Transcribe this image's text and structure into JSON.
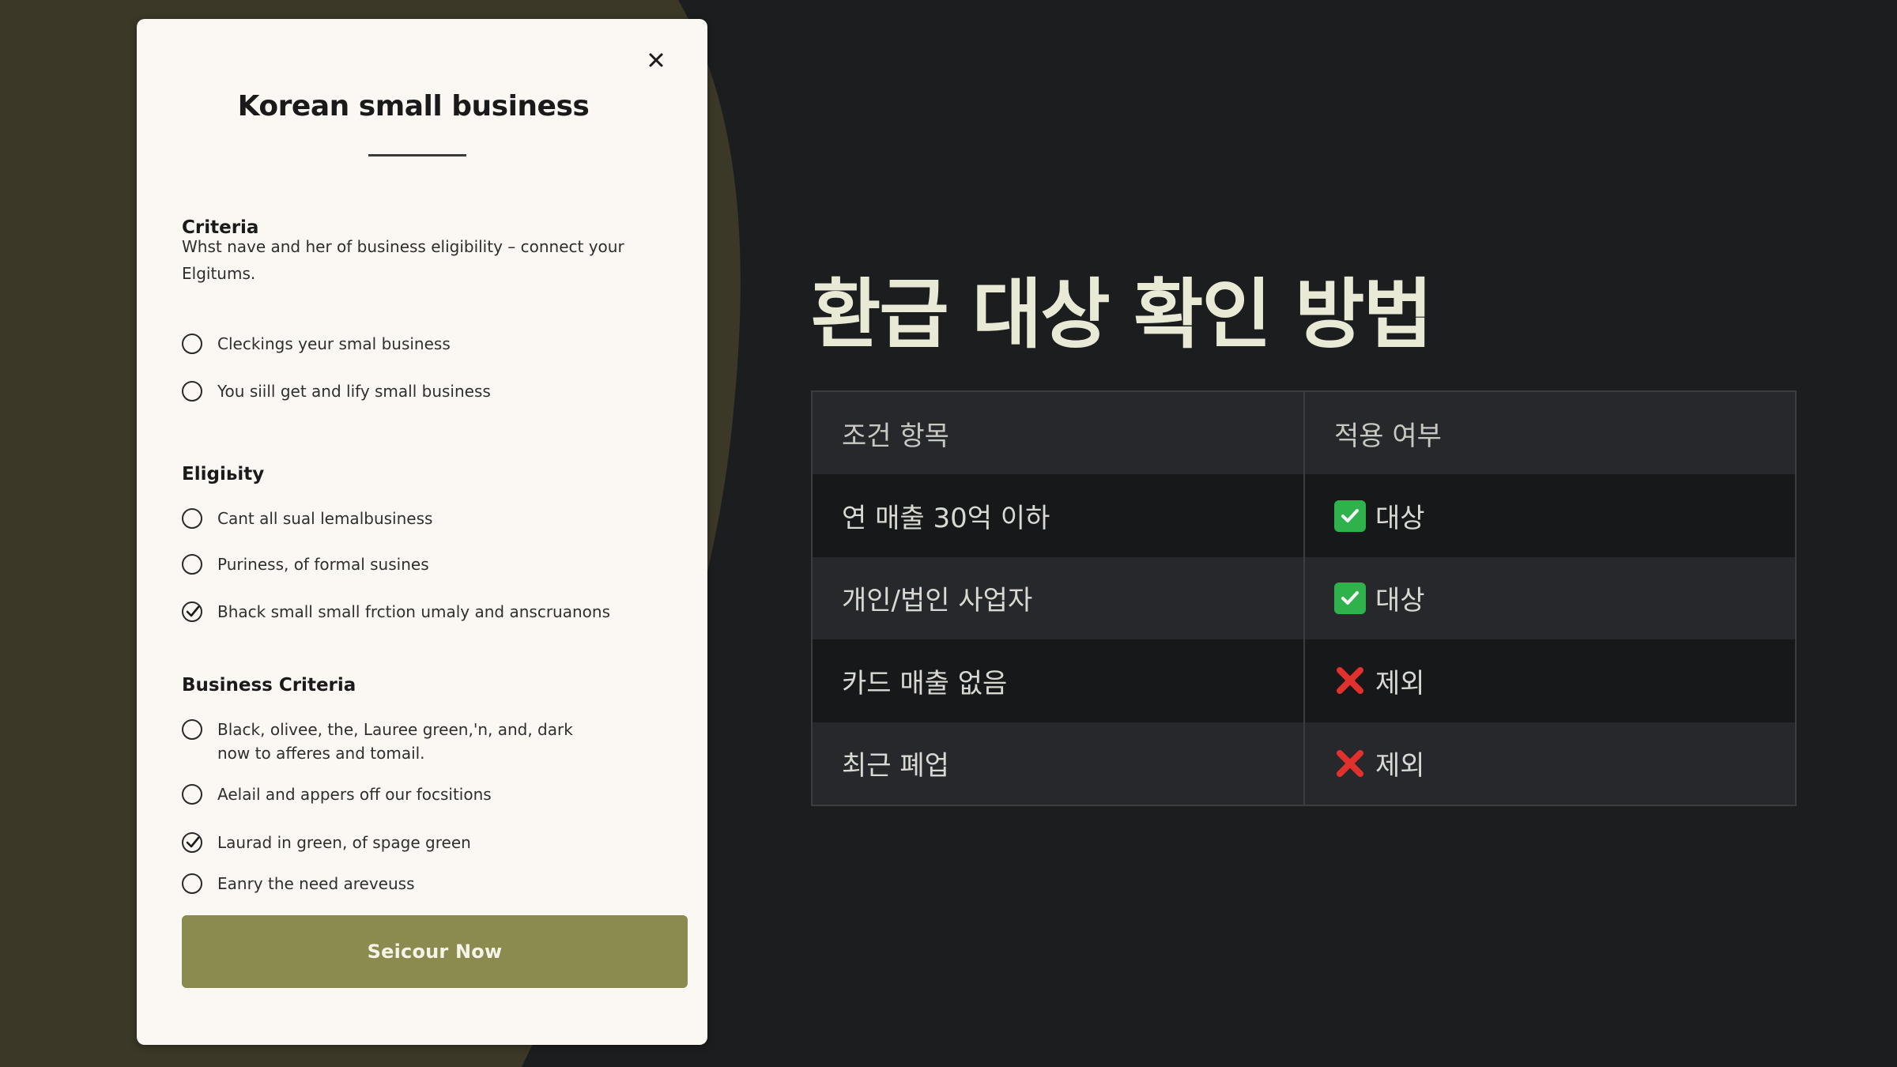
{
  "modal": {
    "title": "Korean small business",
    "close_label": "×",
    "sections": [
      {
        "heading": "Criteria",
        "description": "Whst nave and her of business eligibility – connect your Elgitums.",
        "options": [
          {
            "label": "Cleckings yeur smal business",
            "checked": false
          },
          {
            "label": "You siill get and lify small business",
            "checked": false
          }
        ]
      },
      {
        "heading": "Eligiьity",
        "options": [
          {
            "label": "Cant all sual lemalbusiness",
            "checked": false
          },
          {
            "label": "Puriness, of formal susines",
            "checked": false
          },
          {
            "label": "Bhack small small frction umaly and anscruanons",
            "checked": true
          }
        ]
      },
      {
        "heading": "Business Criteria",
        "options": [
          {
            "label": "Black, olivee, the, Lauree green,'n, and, dark",
            "label_line2": "now to afferes and tomail.",
            "checked": false
          },
          {
            "label": "Aelail and appers off our focsitions",
            "checked": false
          },
          {
            "label": "Laurad in green, of spage green",
            "checked": true
          },
          {
            "label": "Eanry the need areveuss",
            "checked": false
          }
        ]
      }
    ],
    "button_label": "Seicour Now",
    "colors": {
      "button": "#8b8a4f",
      "card": "#fbf7f2"
    }
  },
  "panel": {
    "title": "환급 대상 확인 방법",
    "table": {
      "headers": [
        "조건 항목",
        "적용 여부"
      ],
      "rows": [
        {
          "condition": "연 매출 30억 이하",
          "status": "대상",
          "icon": "check-mark-icon"
        },
        {
          "condition": "개인/법인 사업자",
          "status": "대상",
          "icon": "check-mark-icon"
        },
        {
          "condition": "카드 매출 없음",
          "status": "제외",
          "icon": "cross-mark-icon"
        },
        {
          "condition": "최근 폐업",
          "status": "제외",
          "icon": "cross-mark-icon"
        }
      ]
    },
    "colors": {
      "background": "#1c1d1f",
      "title": "#e9ead6",
      "olive_edge": "#3b3827"
    }
  }
}
